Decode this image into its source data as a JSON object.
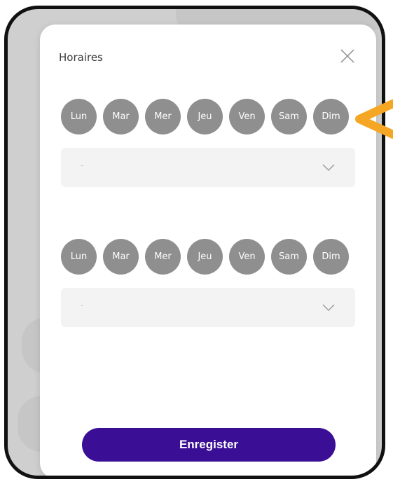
{
  "modal": {
    "title": "Horaires",
    "close_icon": "close-icon",
    "schedules": [
      {
        "days": [
          "Lun",
          "Mar",
          "Mer",
          "Jeu",
          "Ven",
          "Sam",
          "Dim"
        ],
        "select_value": "-",
        "chevron_icon": "chevron-down-icon"
      },
      {
        "days": [
          "Lun",
          "Mar",
          "Mer",
          "Jeu",
          "Ven",
          "Sam",
          "Dim"
        ],
        "select_value": "-",
        "chevron_icon": "chevron-down-icon"
      }
    ],
    "save_label": "Enregister"
  },
  "colors": {
    "day_circle": "#8f8f8f",
    "select_bg": "#f3f3f3",
    "save_button": "#3a0f96",
    "pointer_arrow": "#f5a623",
    "frame_border": "#111111"
  }
}
